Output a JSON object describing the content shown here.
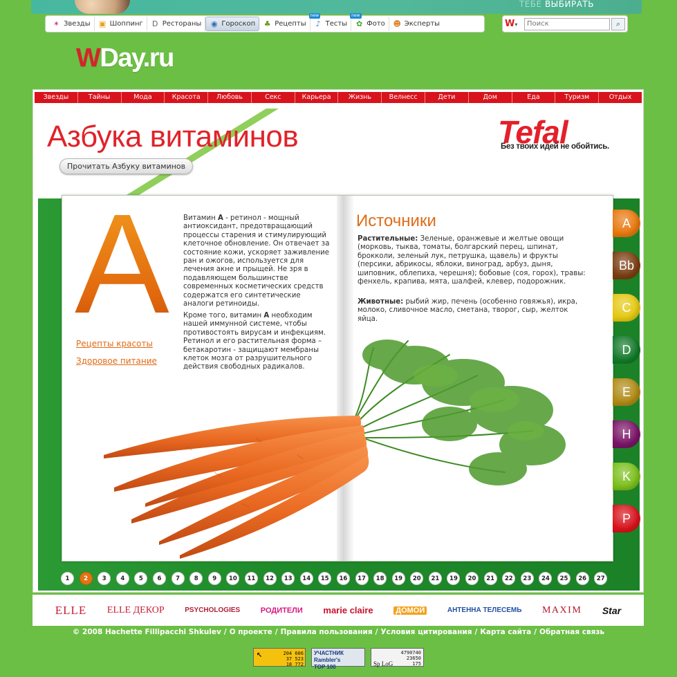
{
  "banner": {
    "prefix": "ТЕБЕ",
    "text": "ВЫБИРАТЬ"
  },
  "nav": {
    "items": [
      {
        "label": "Звезды",
        "icon": "star-icon",
        "glyph": "✶",
        "color": "#d43a8a",
        "active": false,
        "new": false
      },
      {
        "label": "Шоппинг",
        "icon": "shopping-bag-icon",
        "glyph": "▣",
        "color": "#e6a21a",
        "active": false,
        "new": false
      },
      {
        "label": "Рестораны",
        "icon": "restaurant-icon",
        "glyph": "D",
        "color": "#666666",
        "active": false,
        "new": false
      },
      {
        "label": "Гороскоп",
        "icon": "globe-icon",
        "glyph": "◉",
        "color": "#2a6fb5",
        "active": true,
        "new": false
      },
      {
        "label": "Рецепты",
        "icon": "recipe-icon",
        "glyph": "♣",
        "color": "#6a9a1f",
        "active": false,
        "new": false
      },
      {
        "label": "Тесты",
        "icon": "test-icon",
        "glyph": "♪",
        "color": "#3a7ad0",
        "active": false,
        "new": true
      },
      {
        "label": "Фото",
        "icon": "photo-icon",
        "glyph": "✿",
        "color": "#4aa52a",
        "active": false,
        "new": true
      },
      {
        "label": "Эксперты",
        "icon": "expert-icon",
        "glyph": "☻",
        "color": "#e0852c",
        "active": false,
        "new": false
      }
    ],
    "new_label": "new"
  },
  "search": {
    "logo": "W",
    "logo_arrow": "▾",
    "placeholder": "Поиск",
    "button_glyph": "⌕"
  },
  "logo": {
    "w": "W",
    "rest": "Day.ru"
  },
  "categories": [
    "Звезды",
    "Тайны",
    "Мода",
    "Красота",
    "Любовь",
    "Секс",
    "Карьера",
    "Жизнь",
    "Велнесс",
    "Дети",
    "Дом",
    "Еда",
    "Туризм",
    "Отдых"
  ],
  "header": {
    "title": "Азбука витаминов",
    "read_button": "Прочитать Азбуку витаминов",
    "brand": "Tefal",
    "slogan": "Без твоих идей не обойтись."
  },
  "article": {
    "letter": "A",
    "links": [
      "Рецепты красоты",
      "Здоровое питание"
    ],
    "desc1_pre": "Витамин ",
    "desc1_bold": "А",
    "desc1_post": " - ретинол - мощный антиоксидант, предотвращающий процессы старения и стимулирующий клеточное обновление. Он отвечает за состояние кожи, ускоряет заживление ран и ожогов, используется для лечения акне и прыщей. Не зря в подавляющем большинстве современных косметических средств содержатся его синтетические аналоги ретиноиды.",
    "desc2_pre": "Кроме того, витамин ",
    "desc2_bold": "А",
    "desc2_post": " необходим нашей иммунной системе, чтобы противостоять вирусам и инфекциям. Ретинол и его растительная форма – бетакаротин - защищают мембраны клеток мозга от разрушительного действия свободных радикалов.",
    "sources_title": "Источники",
    "plants_label": "Растительные:",
    "plants_text": " Зеленые, оранжевые и желтые овощи (морковь, тыква, томаты, болгарский перец, шпинат, брокколи, зеленый лук, петрушка, щавель) и фрукты (персики, абрикосы, яблоки, виноград, арбуз, дыня, шиповник, облепиха, черешня);  бобовые (соя, горох), травы: фенхель, крапива, мята, шалфей, клевер, подорожник.",
    "animals_label": "Животные:",
    "animals_text": " рыбий жир, печень (особенно говяжья), икра, молоко, сливочное масло, сметана, творог, сыр, желток яйца."
  },
  "vitamin_tabs": [
    {
      "label": "A",
      "color": "#e8780f"
    },
    {
      "label": "Bb",
      "color": "#7a3e12"
    },
    {
      "label": "C",
      "color": "#e5c812"
    },
    {
      "label": "D",
      "color": "#137a2a"
    },
    {
      "label": "E",
      "color": "#b08a16"
    },
    {
      "label": "H",
      "color": "#7a1466"
    },
    {
      "label": "K",
      "color": "#7cbf1c"
    },
    {
      "label": "P",
      "color": "#d8131c"
    }
  ],
  "pager": {
    "pages": [
      "1",
      "2",
      "3",
      "4",
      "5",
      "6",
      "7",
      "8",
      "9",
      "10",
      "11",
      "12",
      "13",
      "14",
      "15",
      "16",
      "17",
      "18",
      "19",
      "20",
      "21",
      "19",
      "20",
      "21",
      "22",
      "23",
      "24",
      "25",
      "26",
      "27"
    ],
    "active_index": 1
  },
  "brands": [
    "ELLE",
    "ELLE ДЕКОР",
    "PSYCHOLOGIES",
    "РОДИТЕЛИ",
    "marie claire",
    "ДОМОЙ",
    "АНТЕННА ТЕЛЕСЕМЬ",
    "MAXIM",
    "Star"
  ],
  "footer": {
    "links": [
      "© 2008 Hachette Fillipacchi Shkulev",
      "О проекте",
      "Правила пользования",
      "Условия цитирования",
      "Карта сайта",
      "Обратная связь"
    ],
    "counter1": [
      "204 606",
      "37 523",
      "18 772"
    ],
    "counter2": [
      "УЧАСТНИК",
      "Rambler's",
      "TOP 100"
    ],
    "counter3": [
      "4790740",
      "23650",
      "175"
    ],
    "counter3_logo": "Sp LoG"
  }
}
